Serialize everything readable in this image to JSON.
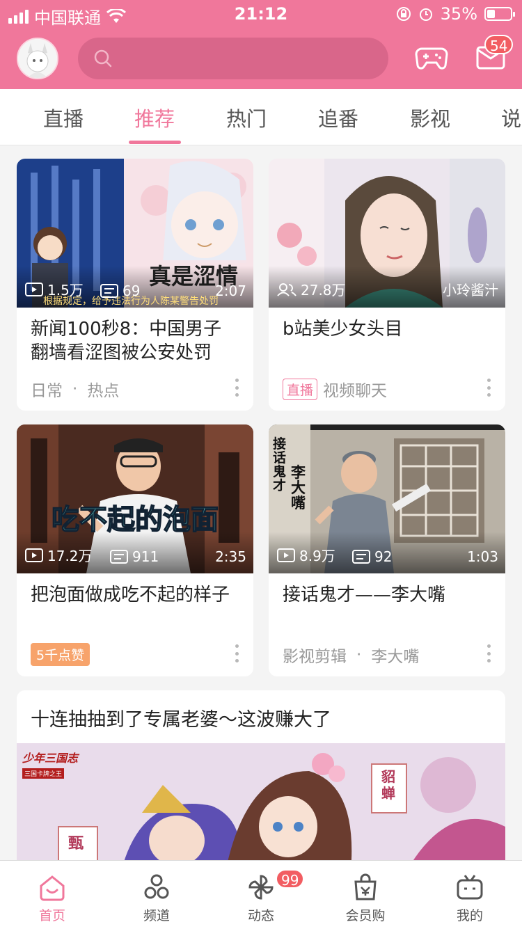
{
  "status_bar": {
    "carrier": "中国联通",
    "time": "21:12",
    "battery": "35%",
    "battery_level": 0.35
  },
  "header": {
    "mail_count": "54"
  },
  "tabs": [
    {
      "label": "直播"
    },
    {
      "label": "推荐"
    },
    {
      "label": "热门"
    },
    {
      "label": "追番"
    },
    {
      "label": "影视"
    },
    {
      "label": "说"
    }
  ],
  "active_tab": "推荐",
  "cards": [
    {
      "title": "新闻100秒8：中国男子翻墙看涩图被公安处罚",
      "views": "1.5万",
      "comments": "69",
      "duration": "2:07",
      "tags": [
        "日常",
        "热点"
      ],
      "overlay": "真是涩情",
      "caption": "根据规定，给予违法行为人陈某警告处罚"
    },
    {
      "title": "b站美少女头目",
      "viewers": "27.8万",
      "uploader": "小玲酱汁",
      "live_tag": "直播",
      "category": "视频聊天"
    },
    {
      "title": "把泡面做成吃不起的样子",
      "views": "17.2万",
      "comments": "911",
      "duration": "2:35",
      "badge": "5千点赞",
      "overlay": "吃不起的泡面"
    },
    {
      "title": "接话鬼才——李大嘴",
      "views": "8.9万",
      "comments": "92",
      "duration": "1:03",
      "tags": [
        "影视剪辑",
        "李大嘴"
      ],
      "overlay_vertical_1": "接话鬼才",
      "overlay_vertical_2": "李大嘴"
    }
  ],
  "big_card": {
    "title": "十连抽抽到了专属老婆～这波赚大了",
    "badge_left": "甄",
    "badge_right": "貂蝉",
    "logo_text": "少年三国志",
    "logo_sub": "三国卡牌之王"
  },
  "tab_bar": {
    "items": [
      {
        "label": "首页"
      },
      {
        "label": "频道"
      },
      {
        "label": "动态"
      },
      {
        "label": "会员购"
      },
      {
        "label": "我的"
      }
    ],
    "dynamic_count": "99"
  },
  "colors": {
    "brand": "#f0779b",
    "badge_red": "#f25d62",
    "like_orange": "#f7a36b"
  }
}
